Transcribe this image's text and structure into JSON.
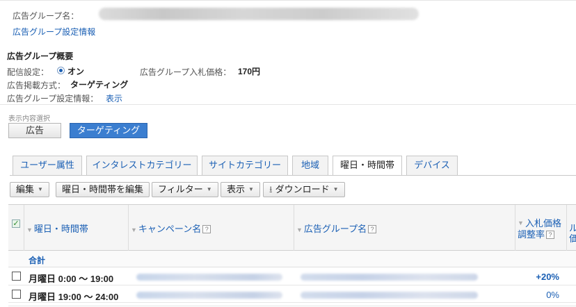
{
  "ad_group": {
    "name_label": "広告グループ名：",
    "settings_link": "広告グループ設定情報"
  },
  "summary": {
    "title": "広告グループ概要",
    "delivery_label": "配信設定：",
    "delivery_value": "オン",
    "bid_label": "広告グループ入札価格：",
    "bid_value": "170円",
    "method_label": "広告掲載方式：",
    "method_value": "ターゲティング",
    "settings_label": "広告グループ設定情報：",
    "settings_link": "表示"
  },
  "view_select": {
    "label": "表示内容選択",
    "buttons": [
      "広告",
      "ターゲティング"
    ],
    "selected": "ターゲティング"
  },
  "tabs": [
    "ユーザー属性",
    "インタレストカテゴリー",
    "サイトカテゴリー",
    "地域",
    "曜日・時間帯",
    "デバイス"
  ],
  "active_tab": "曜日・時間帯",
  "toolbar": {
    "edit": "編集",
    "edit_schedule": "曜日・時間帯を編集",
    "filter": "フィルター",
    "display": "表示",
    "download": "ダウンロード"
  },
  "table": {
    "headers": {
      "day_time": "曜日・時間帯",
      "campaign": "キャンペーン名",
      "ad_group": "広告グループ名",
      "bid_adj_1": "入札価格",
      "bid_adj_2": "調整率",
      "next_1": "ル",
      "next_2": "価"
    },
    "total_label": "合計",
    "rows": [
      {
        "day_time": "月曜日 0:00 ～ 19:00",
        "bid_adj": "+20%"
      },
      {
        "day_time": "月曜日 19:00 ～ 24:00",
        "bid_adj": "0%"
      }
    ]
  },
  "colors": {
    "link": "#1a5fb4",
    "selected_button": "#3b7ed0"
  }
}
